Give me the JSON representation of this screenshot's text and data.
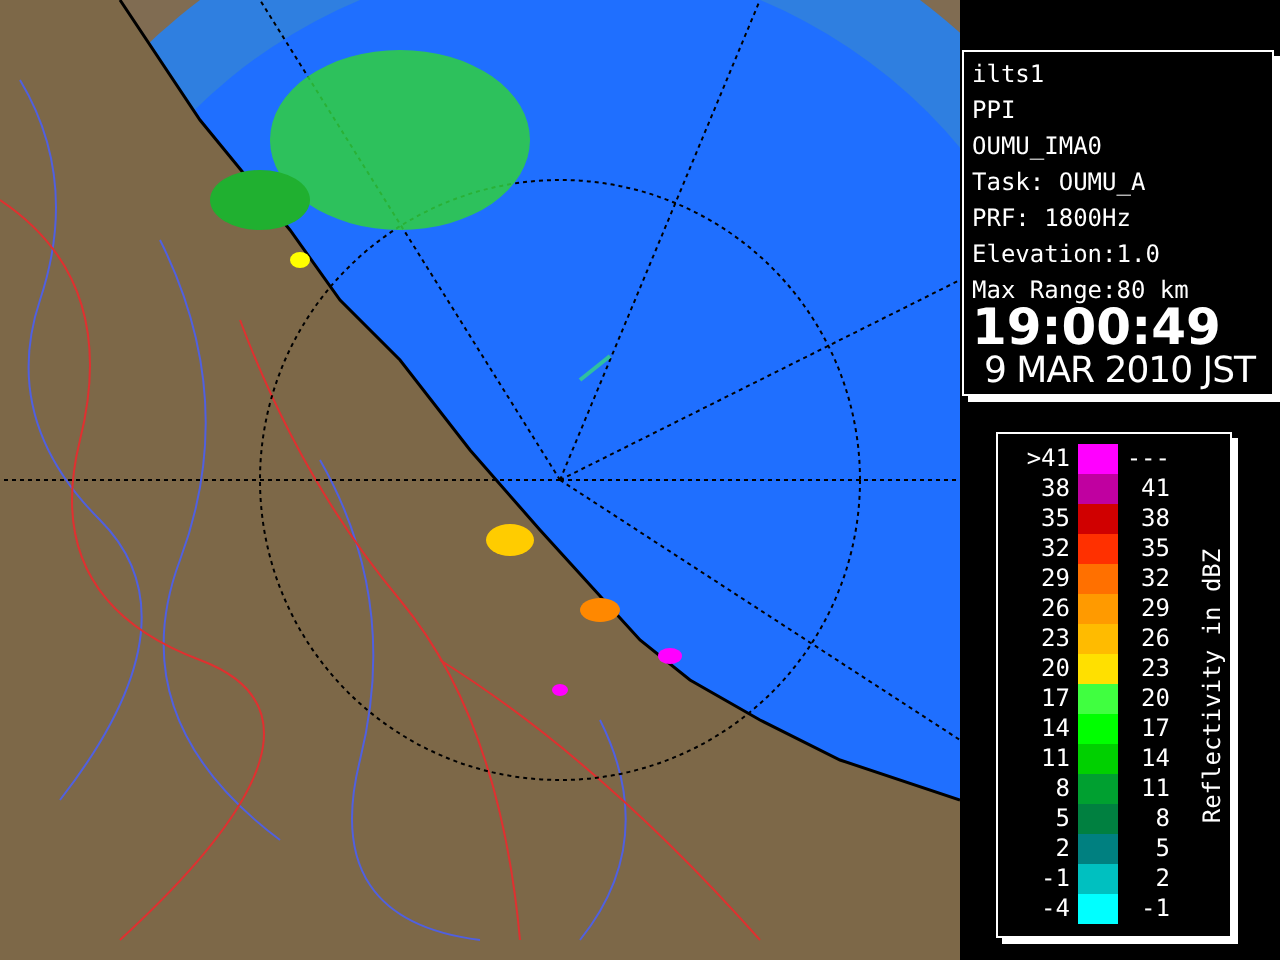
{
  "info": {
    "lines": [
      "ilts1",
      "PPI",
      "OUMU_IMA0",
      "Task: OUMU_A",
      "PRF: 1800Hz",
      "Elevation:1.0",
      "Max Range:80 km"
    ],
    "time": "19:00:49",
    "date": "9 MAR 2010 JST"
  },
  "legend": {
    "title": "Reflectivity in dBZ",
    "rows": [
      {
        "low": ">41",
        "high": "---",
        "color": "#ff00ff"
      },
      {
        "low": "38",
        "high": "41",
        "color": "#c000a0"
      },
      {
        "low": "35",
        "high": "38",
        "color": "#d00000"
      },
      {
        "low": "32",
        "high": "35",
        "color": "#ff3000"
      },
      {
        "low": "29",
        "high": "32",
        "color": "#ff7000"
      },
      {
        "low": "26",
        "high": "29",
        "color": "#ff9a00"
      },
      {
        "low": "23",
        "high": "26",
        "color": "#ffbb00"
      },
      {
        "low": "20",
        "high": "23",
        "color": "#ffe000"
      },
      {
        "low": "17",
        "high": "20",
        "color": "#40ff40"
      },
      {
        "low": "14",
        "high": "17",
        "color": "#00ff00"
      },
      {
        "low": "11",
        "high": "14",
        "color": "#00d000"
      },
      {
        "low": "8",
        "high": "11",
        "color": "#00a030"
      },
      {
        "low": "5",
        "high": "8",
        "color": "#008040"
      },
      {
        "low": "2",
        "high": "5",
        "color": "#008080"
      },
      {
        "low": "-1",
        "high": "2",
        "color": "#00c0c0"
      },
      {
        "low": "-4",
        "high": "-1",
        "color": "#00ffff"
      }
    ]
  }
}
